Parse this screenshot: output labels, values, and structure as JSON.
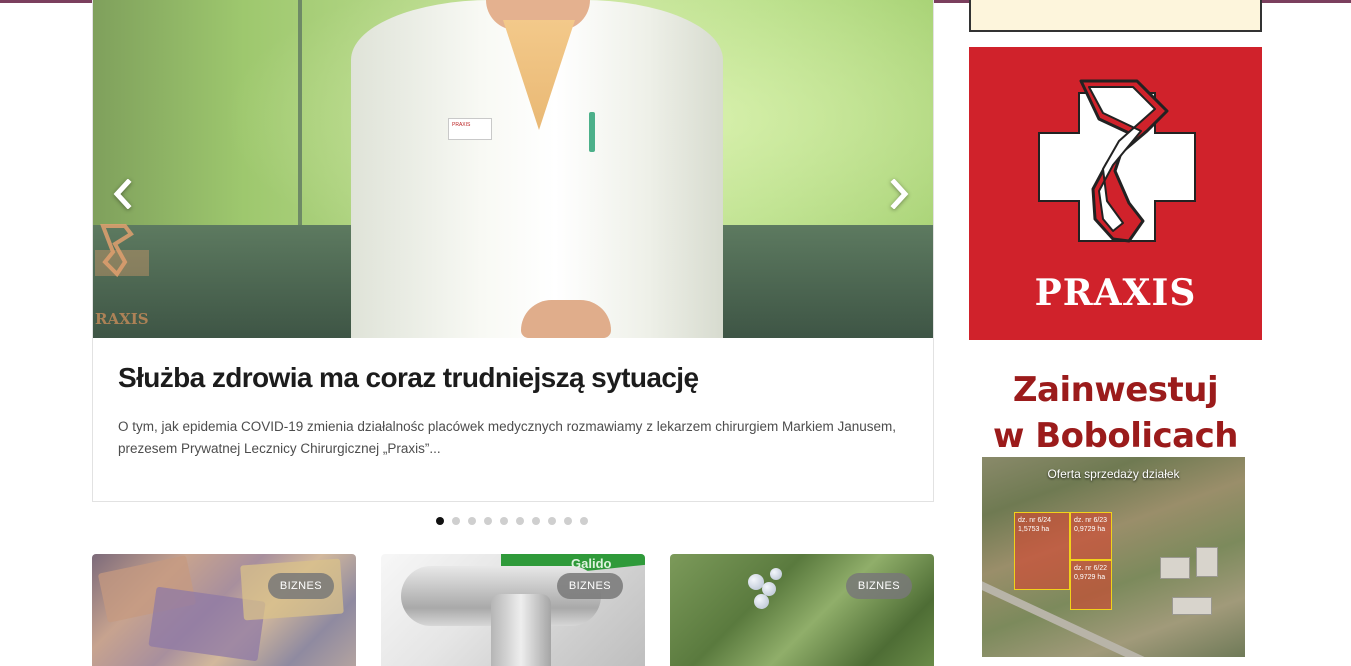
{
  "colors": {
    "top_strip": "#7b3f5e",
    "title_text": "#1c1c1c",
    "excerpt_text": "#4d4d4d",
    "praxis_red": "#d0222b",
    "invest_red": "#9b1b1b",
    "tag_bg": "#787878"
  },
  "slider": {
    "title": "Służba zdrowia ma coraz trudniejszą sytuację",
    "excerpt": "O tym, jak epidemia COVID-19 zmienia działalnośc placówek medycznych rozmawiamy z lekarzem chirurgiem Markiem Janusem, prezesem Prywatnej Lecznicy Chirurgicznej „Praxis”...",
    "prev_icon": "chevron-left-icon",
    "next_icon": "chevron-right-icon",
    "photo_wall_logo_text": "RAXIS",
    "photo_badge_text": "PRAXIS",
    "dots_count": 10,
    "active_dot": 1
  },
  "cards": [
    {
      "tag": "BIZNES",
      "image": "banknotes-photo"
    },
    {
      "tag": "BIZNES",
      "image": "water-pipe-photo",
      "image_text": "Galido"
    },
    {
      "tag": "BIZNES",
      "image": "blueberry-bush-photo"
    }
  ],
  "sidebar": {
    "praxis_ad": {
      "brand": "PRAXIS",
      "logo": "praxis-cross-logo"
    },
    "invest_ad": {
      "line1": "Zainwestuj",
      "line2": "w Bobolicach",
      "map_caption": "Oferta sprzedaży działek",
      "plots": [
        {
          "label": "dz. nr 6/24",
          "area": "1,5753 ha"
        },
        {
          "label": "dz. nr 6/23",
          "area": "0,9729 ha"
        },
        {
          "label": "dz. nr 6/22",
          "area": "0,9729 ha"
        }
      ]
    }
  }
}
